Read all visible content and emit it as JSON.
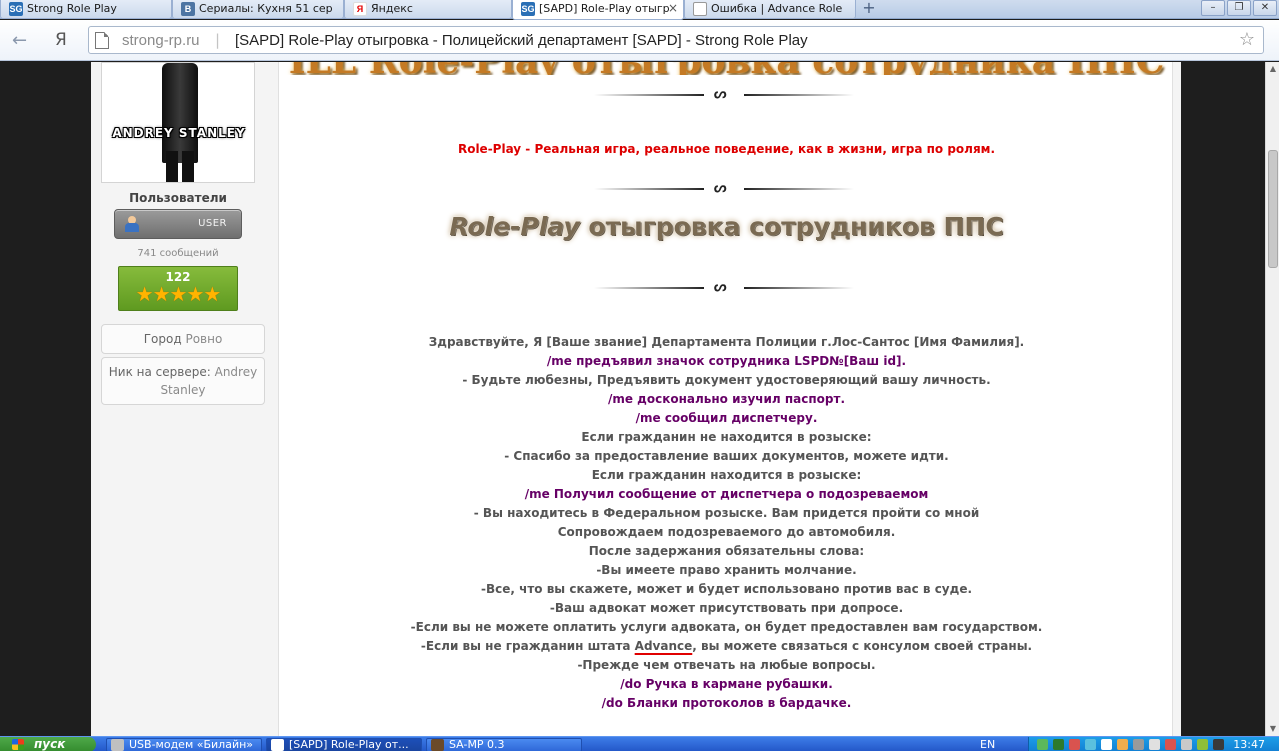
{
  "browser": {
    "tabs": [
      {
        "label": "Strong Role Play",
        "favicon": "sg-icon",
        "active": false
      },
      {
        "label": "Сериалы: Кухня 51 сер",
        "favicon": "vk-icon",
        "active": false
      },
      {
        "label": "Яндекс",
        "favicon": "yandex-icon",
        "active": false
      },
      {
        "label": "[SAPD] Role-Play отыгр",
        "favicon": "sg-icon",
        "active": true
      },
      {
        "label": "Ошибка | Advance Role",
        "favicon": "document-icon",
        "active": false
      }
    ],
    "new_tab_symbol": "+",
    "back_symbol": "←",
    "yandex_symbol": "Я",
    "address": {
      "domain": "strong-rp.ru",
      "separator": "|",
      "page_title": "[SAPD] Role-Play отыгровка - Полицейский департамент [SAPD] - Strong Role Play"
    },
    "star_symbol": "☆"
  },
  "sidebar": {
    "avatar_name": "ANDREY STANLEY",
    "group": "Пользователи",
    "badge": "USER",
    "posts": "741 сообщений",
    "reputation": "122",
    "stars": "★★★★★",
    "city_label": "Город",
    "city_value": "Ровно",
    "nick_label": "Ник на сервере:",
    "nick_value": "Andrey Stanley"
  },
  "post": {
    "title_strip": "ILL Role-Play отыгровка сотрудника ППС",
    "rp_definition": "Role-Play - Реальная игра, реальное поведение, как в жизни, игра по ролям.",
    "heading_italic": "Role-Play",
    "heading_rest": " отыгровка сотрудников ППС",
    "divider_knot": "ᔕ",
    "lines": [
      {
        "text": "Здравствуйте, Я [Ваше звание] Департамента Полиции г.Лос-Сантос [Имя Фамилия].",
        "cmd": false
      },
      {
        "text": "/me предъявил значок сотрудника LSPD№[Ваш id].",
        "cmd": true
      },
      {
        "text": "- Будьте любезны, Предъявить документ удостоверяющий вашу личность.",
        "cmd": false
      },
      {
        "text": "/me досконально изучил паспорт.",
        "cmd": true
      },
      {
        "text": "/me сообщил диспетчеру.",
        "cmd": true
      },
      {
        "text": "Если гражданин не находится в розыске:",
        "cmd": false
      },
      {
        "text": "- Спасибо за предоставление ваших документов, можете идти.",
        "cmd": false
      },
      {
        "text": "Если гражданин находится в розыске:",
        "cmd": false
      },
      {
        "text": "/me Получил сообщение от диспетчера о подозреваемом",
        "cmd": true
      },
      {
        "text": "- Вы находитесь в Федеральном розыске. Вам придется пройти со мной",
        "cmd": false
      },
      {
        "text": "Сопровождаем подозреваемого до автомобиля.",
        "cmd": false
      },
      {
        "text": "После задержания обязательны слова:",
        "cmd": false
      },
      {
        "text": "-Вы имеете право хранить молчание.",
        "cmd": false
      },
      {
        "text": "-Все, что вы скажете, может и будет использовано против вас в суде.",
        "cmd": false
      },
      {
        "text": "-Ваш адвокат может присутствовать при допросе.",
        "cmd": false
      },
      {
        "text": "-Если вы не можете оплатить услуги адвоката, он будет предоставлен вам государством.",
        "cmd": false
      },
      {
        "text_before": "-Если вы не гражданин штата ",
        "text_mark": "Advance",
        "text_after": ", вы можете связаться с консулом своей страны.",
        "cmd": false
      },
      {
        "text": "-Прежде чем отвечать на любые вопросы.",
        "cmd": false
      },
      {
        "text": "/do Ручка в кармане рубашки.",
        "cmd": true
      },
      {
        "text": "/do Бланки протоколов в бардачке.",
        "cmd": true
      }
    ]
  },
  "taskbar": {
    "start": "пуск",
    "tasks": [
      {
        "label": "USB-модем «Билайн»",
        "active": false
      },
      {
        "label": "[SAPD] Role-Play от...",
        "active": true
      },
      {
        "label": "SA-MP 0.3",
        "active": false
      }
    ],
    "language": "EN",
    "clock": "13:47"
  },
  "colors": {
    "cmd": "#660066",
    "rp_red": "#dd0000",
    "text_gray": "#555555",
    "rep_green": "#6aa52a"
  }
}
